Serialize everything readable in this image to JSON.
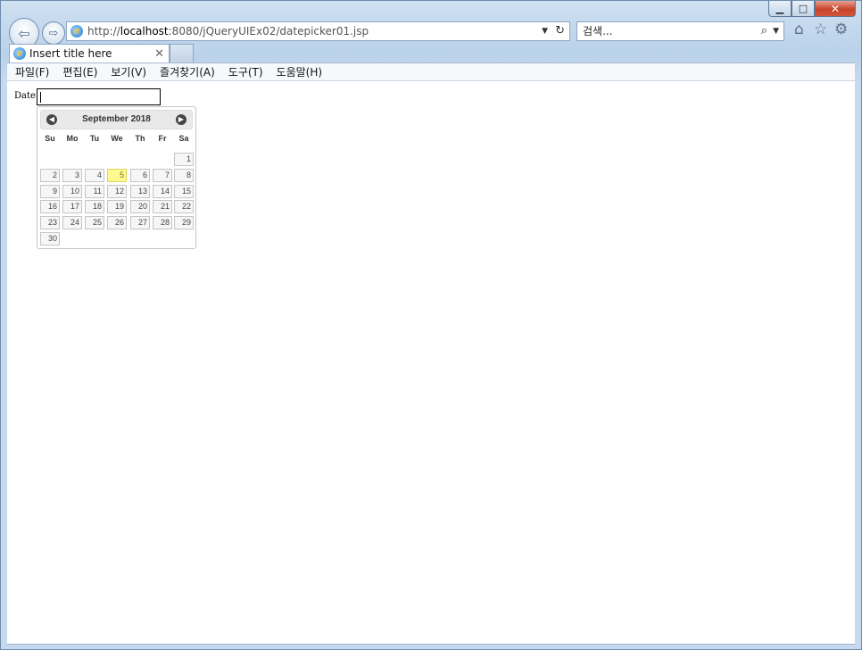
{
  "browser": {
    "url_prefix": "http://",
    "url_host": "localhost",
    "url_rest": ":8080/jQueryUIEx02/datepicker01.jsp",
    "search_placeholder": "검색...",
    "tab_title": "Insert title here"
  },
  "menu": [
    "파일(F)",
    "편집(E)",
    "보기(V)",
    "즐겨찾기(A)",
    "도구(T)",
    "도움말(H)"
  ],
  "form": {
    "date_label": "Date:"
  },
  "datepicker": {
    "title": "September 2018",
    "weekdays": [
      "Su",
      "Mo",
      "Tu",
      "We",
      "Th",
      "Fr",
      "Sa"
    ],
    "weeks": [
      [
        "",
        "",
        "",
        "",
        "",
        "",
        "1"
      ],
      [
        "2",
        "3",
        "4",
        "5",
        "6",
        "7",
        "8"
      ],
      [
        "9",
        "10",
        "11",
        "12",
        "13",
        "14",
        "15"
      ],
      [
        "16",
        "17",
        "18",
        "19",
        "20",
        "21",
        "22"
      ],
      [
        "23",
        "24",
        "25",
        "26",
        "27",
        "28",
        "29"
      ],
      [
        "30",
        "",
        "",
        "",
        "",
        "",
        ""
      ]
    ],
    "today": "5",
    "highlight_color": "#fffa90"
  }
}
